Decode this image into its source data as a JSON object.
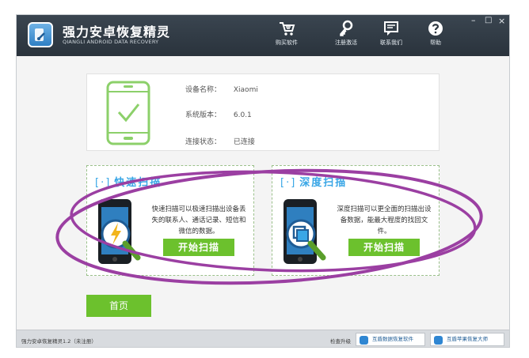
{
  "app": {
    "title": "强力安卓恢复精灵",
    "subtitle": "QIANGLI ANDROID DATA RECOVERY"
  },
  "nav": {
    "buy": "购买软件",
    "register": "注册激活",
    "contact": "联系我们",
    "help": "帮助"
  },
  "window_controls": {
    "minimize": "–",
    "maximize": "□",
    "close": "×"
  },
  "device": {
    "name_label": "设备名称：",
    "name_value": "Xiaomi",
    "version_label": "系统版本：",
    "version_value": "6.0.1",
    "status_label": "连接状态：",
    "status_value": "已连接"
  },
  "scan_modes": {
    "quick": {
      "title": "快速扫描",
      "description": "快速扫描可以极速扫描出设备丢失的联系人、通话记录、短信和微信的数据。",
      "button": "开始扫描"
    },
    "deep": {
      "title": "深度扫描",
      "description": "深度扫描可以更全面的扫描出设备数据，能最大程度的找回文件。",
      "button": "开始扫描"
    }
  },
  "home_button": "首页",
  "footer": {
    "status": "强力安卓恢复精灵1.2（未注册）",
    "check_update": "检查升级",
    "link_data": "互盾数据恢复软件",
    "link_apple": "互盾苹果恢复大师"
  },
  "colors": {
    "titlebar": "#2f3942",
    "accent_green": "#6cc12d",
    "accent_blue": "#39a6e6",
    "annotation": "#9b3fa2"
  }
}
